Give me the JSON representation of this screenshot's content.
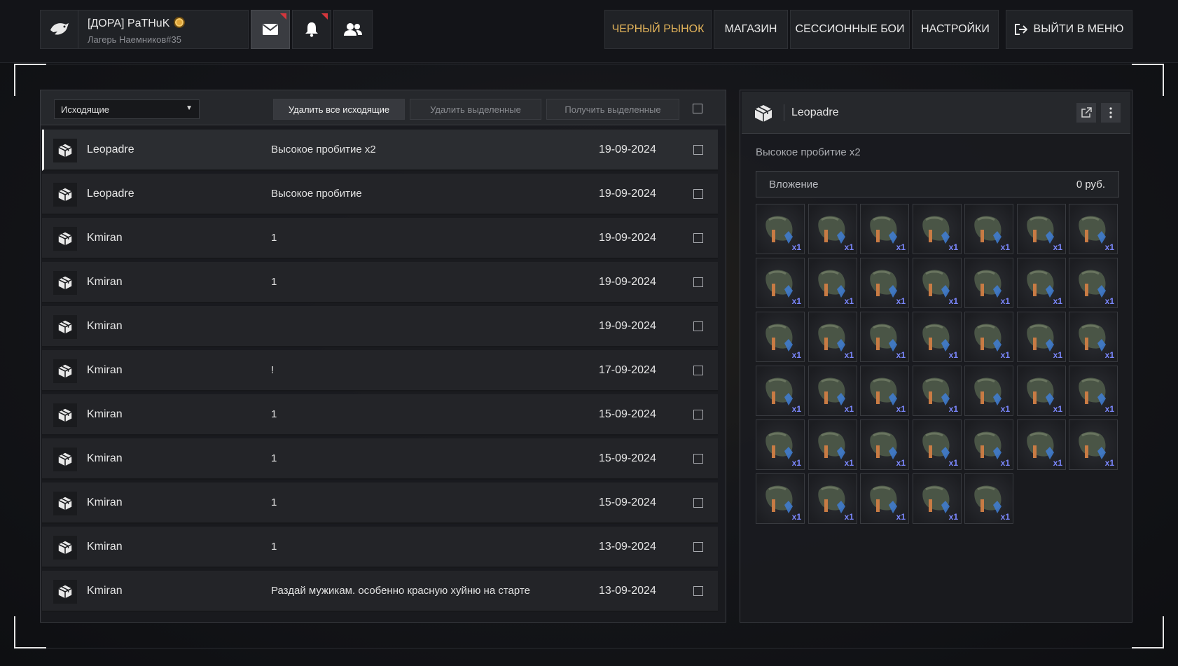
{
  "profile": {
    "name": "[ДОРА] PaTHuK",
    "subtitle": "Лагерь Наемников#35"
  },
  "top_icons": [
    {
      "name": "mail-icon",
      "active": true,
      "notify": true
    },
    {
      "name": "bell-icon",
      "active": false,
      "notify": true
    },
    {
      "name": "friends-icon",
      "active": false,
      "notify": false
    }
  ],
  "nav": {
    "black_market": "ЧЕРНЫЙ РЫНОК",
    "shop": "МАГАЗИН",
    "session_battles": "СЕССИОННЫЕ БОИ",
    "settings": "НАСТРОЙКИ",
    "exit": "ВЫЙТИ В МЕНЮ"
  },
  "toolbar": {
    "filter_value": "Исходящие",
    "delete_all": "Удалить все исходящие",
    "delete_selected": "Удалить выделенные",
    "receive_selected": "Получить выделенные"
  },
  "messages": [
    {
      "sender": "Leopadre",
      "subject": "Высокое пробитие x2",
      "date": "19-09-2024",
      "selected": true
    },
    {
      "sender": "Leopadre",
      "subject": "Высокое пробитие",
      "date": "19-09-2024",
      "selected": false
    },
    {
      "sender": "Kmiran",
      "subject": "1",
      "date": "19-09-2024",
      "selected": false
    },
    {
      "sender": "Kmiran",
      "subject": "1",
      "date": "19-09-2024",
      "selected": false
    },
    {
      "sender": "Kmiran",
      "subject": "",
      "date": "19-09-2024",
      "selected": false
    },
    {
      "sender": "Kmiran",
      "subject": "!",
      "date": "17-09-2024",
      "selected": false
    },
    {
      "sender": "Kmiran",
      "subject": "1",
      "date": "15-09-2024",
      "selected": false
    },
    {
      "sender": "Kmiran",
      "subject": "1",
      "date": "15-09-2024",
      "selected": false
    },
    {
      "sender": "Kmiran",
      "subject": "1",
      "date": "15-09-2024",
      "selected": false
    },
    {
      "sender": "Kmiran",
      "subject": "1",
      "date": "13-09-2024",
      "selected": false
    },
    {
      "sender": "Kmiran",
      "subject": "Раздай мужикам. особенно красную хуйню на старте",
      "date": "13-09-2024",
      "selected": false
    }
  ],
  "detail": {
    "sender": "Leopadre",
    "subject": "Высокое пробитие x2",
    "attachment_label": "Вложение",
    "attachment_amount": "0 руб.",
    "item_quantity_label": "x1",
    "item_count": 40
  },
  "colors": {
    "accent_gold": "#e2b35a",
    "notify_red": "#d4363c",
    "qty_blue": "#7b88ff"
  }
}
